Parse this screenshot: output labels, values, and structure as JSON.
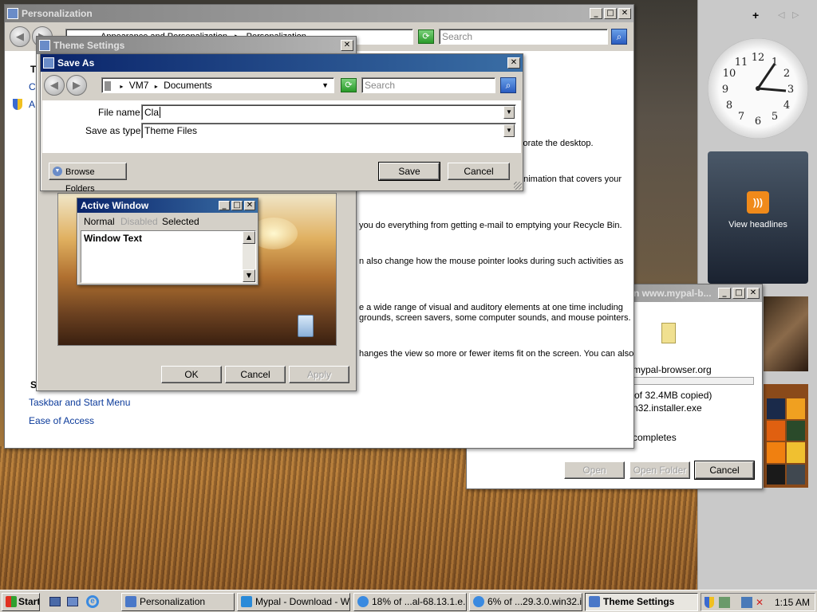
{
  "personalization": {
    "title": "Personalization",
    "breadcrumb": [
      "Appearance and Personalization",
      "Personalization"
    ],
    "search_placeholder": "Search",
    "body_lines": [
      "corate the desktop.",
      "animation that covers your",
      "you do everything from getting e-mail to emptying your Recycle Bin.",
      "n also change how the mouse pointer looks during such activities as",
      "e a wide range of visual and auditory elements at one time including",
      "grounds, screen savers, some computer sounds, and mouse pointers.",
      "hanges the view so more or fewer items fit on the screen. You can also"
    ],
    "left_t": "T",
    "left_cl": "Cl",
    "left_a": "A",
    "left_s": "S",
    "links": [
      "Taskbar and Start Menu",
      "Ease of Access"
    ]
  },
  "theme_settings": {
    "title": "Theme Settings",
    "preview_window_title": "Active Window",
    "preview_menu": [
      "Normal",
      "Disabled",
      "Selected"
    ],
    "preview_text": "Window Text",
    "ok": "OK",
    "cancel": "Cancel",
    "apply": "Apply"
  },
  "save_as": {
    "title": "Save As",
    "path": [
      "VM7",
      "Documents"
    ],
    "search_placeholder": "Search",
    "file_name_label": "File name:",
    "file_name_value": "Cla",
    "type_label": "Save as type:",
    "type_value": "Theme Files",
    "browse_folders": "Browse Folders",
    "save": "Save",
    "cancel": "Cancel"
  },
  "download": {
    "title_fragment": "n www.mypal-b...",
    "host": "mypal-browser.org",
    "progress": " of 32.4MB copied)",
    "filename": "n32.installer.exe",
    "status": "completes",
    "open": "Open",
    "open_folder": "Open Folder",
    "cancel": "Cancel"
  },
  "sidebar": {
    "add": "+",
    "headlines": "View headlines"
  },
  "taskbar": {
    "start": "Start",
    "items": [
      "Personalization",
      "Mypal - Download - W...",
      "18% of ...al-68.13.1.e...",
      "6% of ...29.3.0.win32.i...",
      "Theme Settings"
    ],
    "clock": "1:15 AM"
  }
}
